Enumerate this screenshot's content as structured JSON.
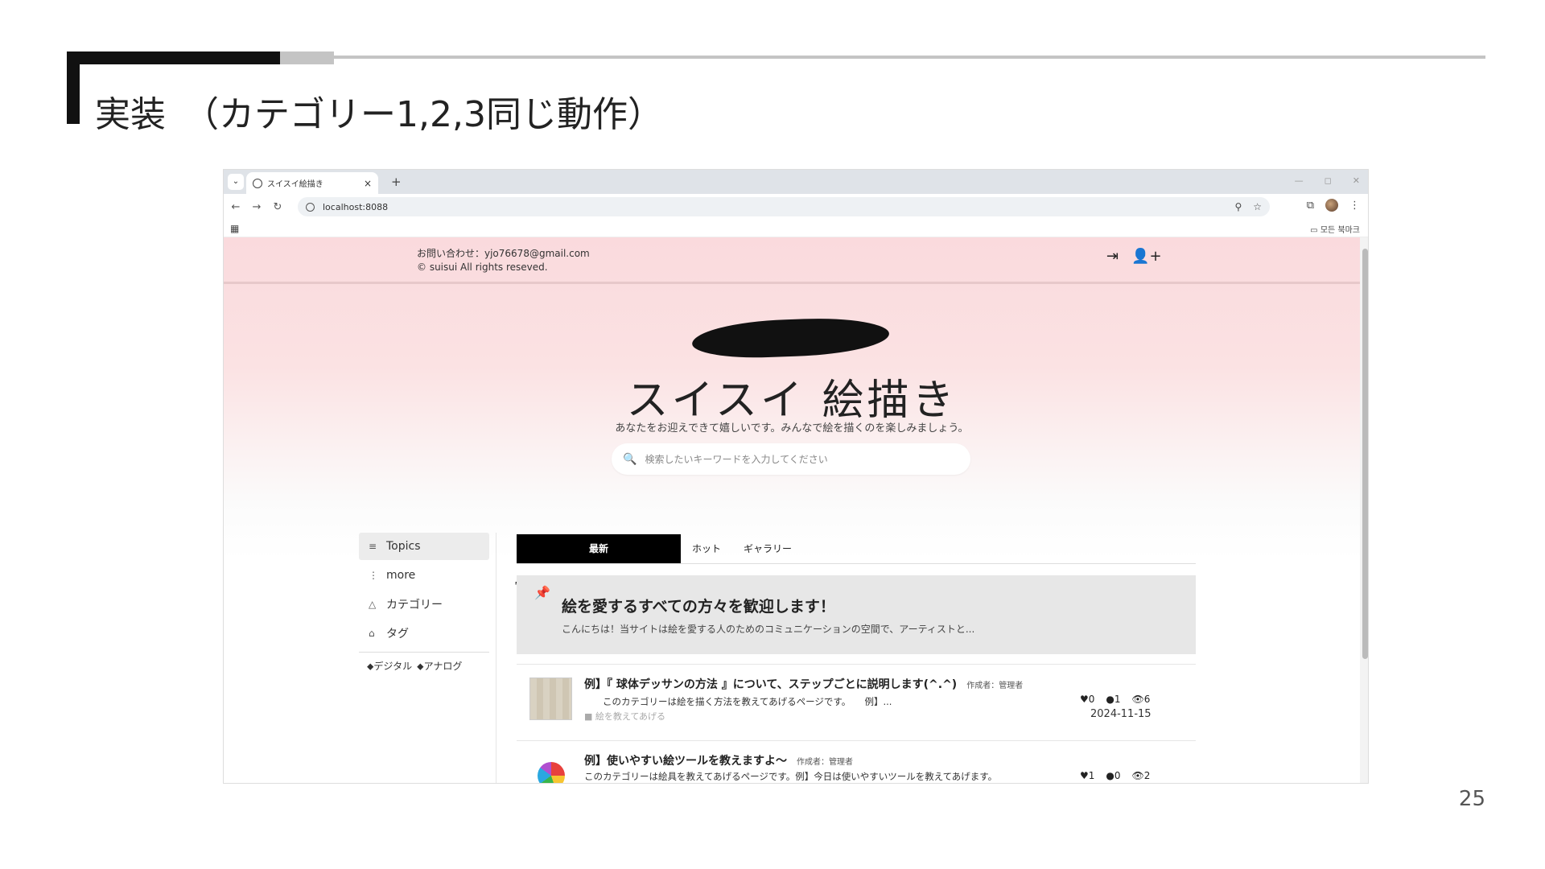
{
  "slide": {
    "title": "実装　（カテゴリー1,2,3同じ動作）",
    "page_number": "25"
  },
  "browser": {
    "tab_title": "スイスイ絵描き",
    "url": "localhost:8088",
    "bookmarks_folder": "모든 북마크"
  },
  "site": {
    "contact": "お問い合わせ：yjo76678@gmail.com",
    "copyright": "© suisui All rights reseved.",
    "title": "スイスイ 絵描き",
    "tagline": "あなたをお迎えできて嬉しいです。みんなで絵を描くのを楽しみましょう。",
    "search_placeholder": "検索したいキーワードを入力してください"
  },
  "sidebar": {
    "items": [
      {
        "label": "Topics",
        "icon": "list-icon"
      },
      {
        "label": "more",
        "icon": "more-vertical-icon"
      },
      {
        "label": "カテゴリー",
        "icon": "shapes-icon"
      },
      {
        "label": "タグ",
        "icon": "tags-icon"
      }
    ],
    "tags": [
      "デジタル",
      "アナログ"
    ]
  },
  "tabs": [
    "最新",
    "ホット",
    "ギャラリー"
  ],
  "pinned": {
    "title": "絵を愛するすべての方々を歓迎します！",
    "excerpt": "こんにちは！当サイトは絵を愛する人のためのコミュニケーションの空間で、アーティストと..."
  },
  "posts": [
    {
      "title": "例】『 球体デッサンの方法 』について、ステップごとに説明します(^.^)",
      "author": "作成者：管理者",
      "excerpt": "　　このカテゴリーは絵を描く方法を教えてあげるページです。　　例】...",
      "category": "絵を教えてあげる",
      "likes": "0",
      "comments": "1",
      "views": "6",
      "date": "2024-11-15"
    },
    {
      "title": "例】使いやすい絵ツールを教えますよ～",
      "author": "作成者：管理者",
      "excerpt": "このカテゴリーは絵具を教えてあげるページです。例】今日は使いやすいツールを教えてあげます。",
      "likes": "1",
      "comments": "0",
      "views": "2"
    }
  ]
}
